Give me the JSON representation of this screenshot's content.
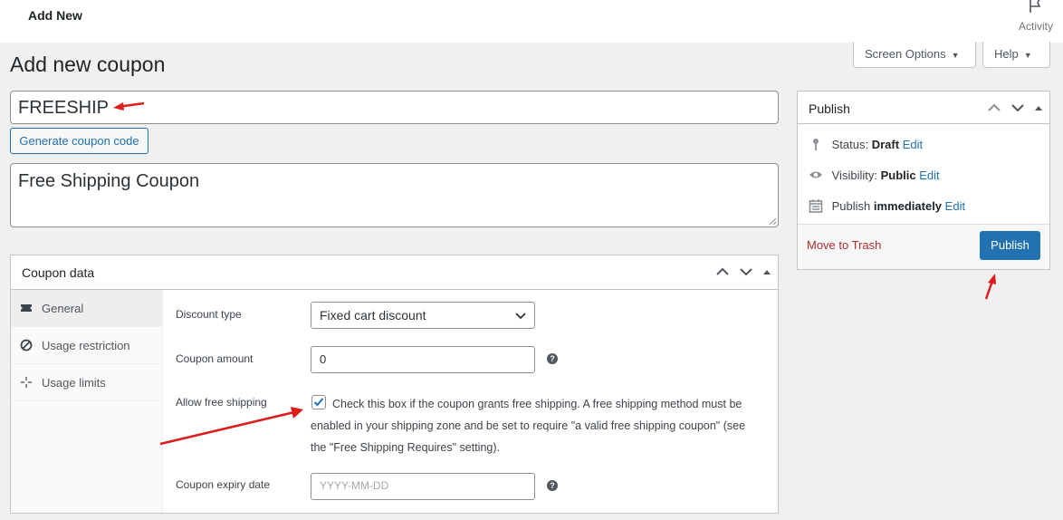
{
  "topbar": {
    "title": "Add New",
    "activity_label": "Activity"
  },
  "header_buttons": {
    "screen_options": "Screen Options",
    "help": "Help"
  },
  "page_title": "Add new coupon",
  "coupon": {
    "code": "FREESHIP",
    "generate_label": "Generate coupon code",
    "description": "Free Shipping Coupon"
  },
  "coupon_data": {
    "title": "Coupon data",
    "tabs": [
      {
        "label": "General",
        "icon": "ticket-icon"
      },
      {
        "label": "Usage restriction",
        "icon": "block-icon"
      },
      {
        "label": "Usage limits",
        "icon": "crosshair-icon"
      }
    ],
    "fields": {
      "discount_type_label": "Discount type",
      "discount_type_value": "Fixed cart discount",
      "amount_label": "Coupon amount",
      "amount_value": "0",
      "free_shipping_label": "Allow free shipping",
      "free_shipping_text": "Check this box if the coupon grants free shipping. A free shipping method must be enabled in your shipping zone and be set to require \"a valid free shipping coupon\" (see the \"Free Shipping Requires\" setting).",
      "free_shipping_checked": true,
      "expiry_label": "Coupon expiry date",
      "expiry_placeholder": "YYYY-MM-DD"
    }
  },
  "publish": {
    "title": "Publish",
    "status_label": "Status:",
    "status_value": "Draft",
    "visibility_label": "Visibility:",
    "visibility_value": "Public",
    "publish_label": "Publish",
    "publish_value": "immediately",
    "edit_label": "Edit",
    "trash_label": "Move to Trash",
    "publish_button": "Publish"
  },
  "colors": {
    "accent": "#2271b1",
    "danger": "#b32d2e",
    "annotation": "#e01b1b"
  }
}
